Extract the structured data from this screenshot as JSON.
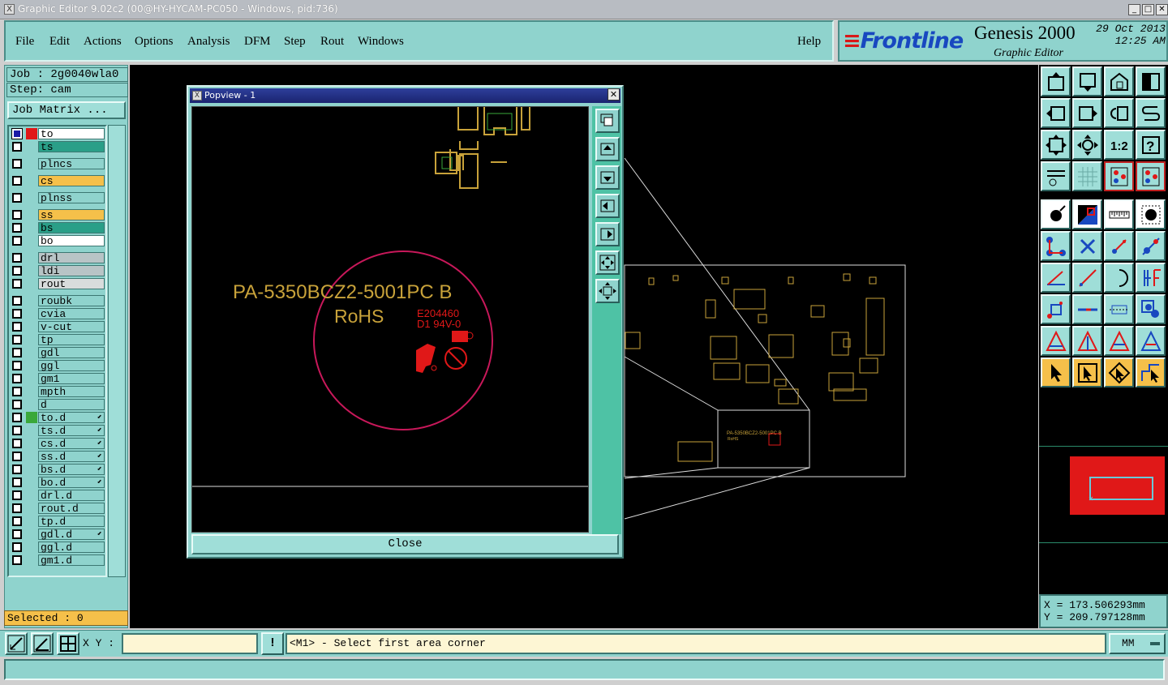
{
  "window": {
    "title": "Graphic Editor 9.02c2 (00@HY-HYCAM-PC050 - Windows, pid:736)",
    "logo_icon": "x-window-icon",
    "controls": [
      "minimize-icon",
      "maximize-icon",
      "close-icon"
    ]
  },
  "menu": {
    "items": [
      "File",
      "Edit",
      "Actions",
      "Options",
      "Analysis",
      "DFM",
      "Step",
      "Rout",
      "Windows"
    ],
    "help": "Help"
  },
  "brand": {
    "logo": "Frontline",
    "product": "Genesis 2000",
    "subtitle": "Graphic Editor",
    "date": "29 Oct 2013",
    "time": "12:25 AM"
  },
  "job": {
    "job_label": "Job : 2g0040wla0",
    "step_label": "Step: cam",
    "matrix_button": "Job Matrix ..."
  },
  "layers": [
    {
      "name": "to",
      "checked": true,
      "swatch": "#e01818",
      "bg": "#ffffff"
    },
    {
      "name": "ts",
      "checked": false,
      "swatch": "",
      "bg": "#2a9f88"
    },
    {
      "name": "plncs",
      "checked": false,
      "swatch": "",
      "bg": "#8fd3cd"
    },
    {
      "name": "cs",
      "checked": false,
      "swatch": "",
      "bg": "#f5c04a"
    },
    {
      "name": "plnss",
      "checked": false,
      "swatch": "",
      "bg": "#8fd3cd"
    },
    {
      "name": "ss",
      "checked": false,
      "swatch": "",
      "bg": "#f5c04a"
    },
    {
      "name": "bs",
      "checked": false,
      "swatch": "",
      "bg": "#2a9f88"
    },
    {
      "name": "bo",
      "checked": false,
      "swatch": "",
      "bg": "#ffffff"
    },
    {
      "name": "drl",
      "checked": false,
      "swatch": "",
      "bg": "#b8c4c6"
    },
    {
      "name": "ldi",
      "checked": false,
      "swatch": "",
      "bg": "#b8c4c6"
    },
    {
      "name": "rout",
      "checked": false,
      "swatch": "",
      "bg": "#d8dcdc"
    },
    {
      "name": "roubk",
      "checked": false,
      "swatch": "",
      "bg": "#8fd3cd"
    },
    {
      "name": "cvia",
      "checked": false,
      "swatch": "",
      "bg": "#8fd3cd"
    },
    {
      "name": "v-cut",
      "checked": false,
      "swatch": "",
      "bg": "#8fd3cd"
    },
    {
      "name": "tp",
      "checked": false,
      "swatch": "",
      "bg": "#8fd3cd"
    },
    {
      "name": "gdl",
      "checked": false,
      "swatch": "",
      "bg": "#8fd3cd"
    },
    {
      "name": "ggl",
      "checked": false,
      "swatch": "",
      "bg": "#8fd3cd"
    },
    {
      "name": "gm1",
      "checked": false,
      "swatch": "",
      "bg": "#8fd3cd"
    },
    {
      "name": "mpth",
      "checked": false,
      "swatch": "",
      "bg": "#8fd3cd"
    },
    {
      "name": "d",
      "checked": false,
      "swatch": "",
      "bg": "#8fd3cd"
    },
    {
      "name": "to.d",
      "checked": false,
      "swatch": "#3aa83a",
      "bg": "#8fd3cd",
      "arrow": true
    },
    {
      "name": "ts.d",
      "checked": false,
      "swatch": "",
      "bg": "#8fd3cd",
      "arrow": true
    },
    {
      "name": "cs.d",
      "checked": false,
      "swatch": "",
      "bg": "#8fd3cd",
      "arrow": true
    },
    {
      "name": "ss.d",
      "checked": false,
      "swatch": "",
      "bg": "#8fd3cd",
      "arrow": true
    },
    {
      "name": "bs.d",
      "checked": false,
      "swatch": "",
      "bg": "#8fd3cd",
      "arrow": true
    },
    {
      "name": "bo.d",
      "checked": false,
      "swatch": "",
      "bg": "#8fd3cd",
      "arrow": true
    },
    {
      "name": "drl.d",
      "checked": false,
      "swatch": "",
      "bg": "#8fd3cd"
    },
    {
      "name": "rout.d",
      "checked": false,
      "swatch": "",
      "bg": "#8fd3cd"
    },
    {
      "name": "tp.d",
      "checked": false,
      "swatch": "",
      "bg": "#8fd3cd"
    },
    {
      "name": "gdl.d",
      "checked": false,
      "swatch": "",
      "bg": "#8fd3cd",
      "arrow": true
    },
    {
      "name": "ggl.d",
      "checked": false,
      "swatch": "",
      "bg": "#8fd3cd"
    },
    {
      "name": "gm1.d",
      "checked": false,
      "swatch": "",
      "bg": "#8fd3cd"
    }
  ],
  "selected": "Selected : 0",
  "popview": {
    "title": "Popview - 1",
    "part_label": "PA-5350BCZ2-5001PC B",
    "rohs": "RoHS",
    "ul_code": "E204460",
    "ul_rating": "D1 94V-0",
    "close_button": "Close",
    "side_tools": [
      "zoom-window-icon",
      "pan-up-icon",
      "pan-down-icon",
      "pan-left-icon",
      "pan-right-icon",
      "zoom-fit-icon",
      "zoom-center-icon"
    ]
  },
  "board": {
    "mini_part_label": "PA-5350BCZ2-5001PC B",
    "mini_rohs": "RoHS"
  },
  "coords": {
    "x": "X = 173.506293mm",
    "y": "Y = 209.797128mm"
  },
  "status": {
    "xy_label": "X Y :",
    "xy_value": "",
    "message": "<M1> - Select first area corner",
    "unit": "MM",
    "warn_button": "!"
  },
  "colors": {
    "panel": "#8fd3cd",
    "gold": "#c8a23a",
    "magenta": "#c8185a",
    "red": "#e01818"
  }
}
